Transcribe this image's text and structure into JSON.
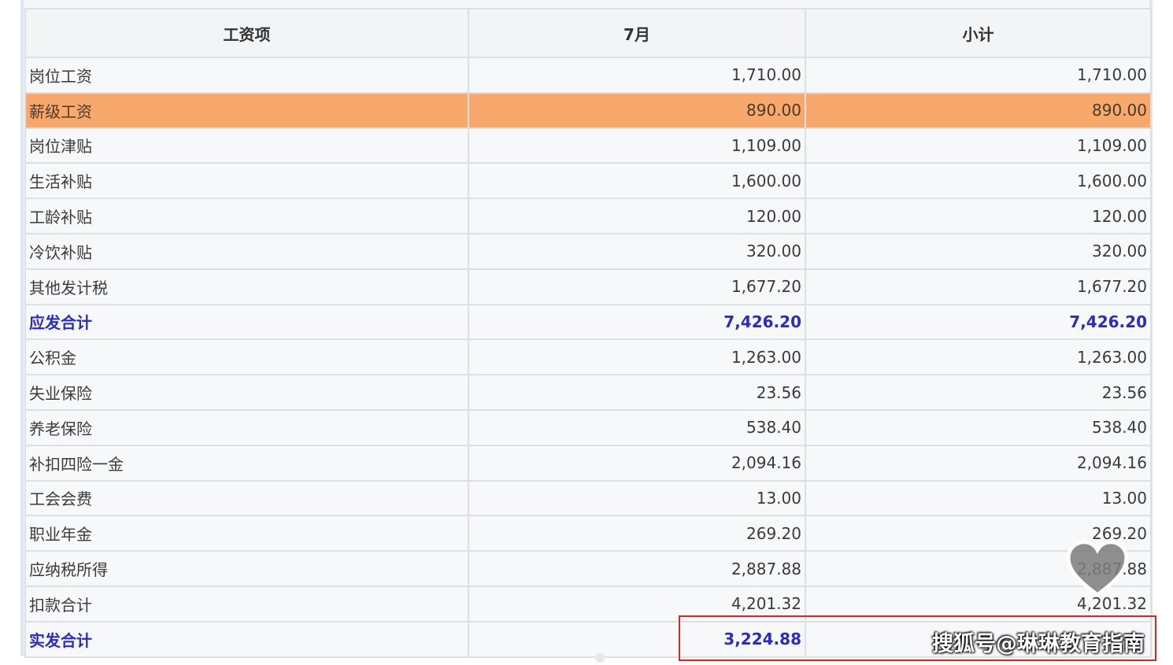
{
  "table": {
    "headers": [
      "工资项",
      "7月",
      "小计"
    ],
    "rows": [
      {
        "item": "岗位工资",
        "july": "1,710.00",
        "subtotal": "1,710.00"
      },
      {
        "item": "薪级工资",
        "july": "890.00",
        "subtotal": "890.00"
      },
      {
        "item": "岗位津贴",
        "july": "1,109.00",
        "subtotal": "1,109.00"
      },
      {
        "item": "生活补贴",
        "july": "1,600.00",
        "subtotal": "1,600.00"
      },
      {
        "item": "工龄补贴",
        "july": "120.00",
        "subtotal": "120.00"
      },
      {
        "item": "冷饮补贴",
        "july": "320.00",
        "subtotal": "320.00"
      },
      {
        "item": "其他发计税",
        "july": "1,677.20",
        "subtotal": "1,677.20"
      },
      {
        "item": "应发合计",
        "july": "7,426.20",
        "subtotal": "7,426.20"
      },
      {
        "item": "公积金",
        "july": "1,263.00",
        "subtotal": "1,263.00"
      },
      {
        "item": "失业保险",
        "july": "23.56",
        "subtotal": "23.56"
      },
      {
        "item": "养老保险",
        "july": "538.40",
        "subtotal": "538.40"
      },
      {
        "item": "补扣四险一金",
        "july": "2,094.16",
        "subtotal": "2,094.16"
      },
      {
        "item": "工会会费",
        "july": "13.00",
        "subtotal": "13.00"
      },
      {
        "item": "职业年金",
        "july": "269.20",
        "subtotal": "269.20"
      },
      {
        "item": "应纳税所得",
        "july": "2,887.88",
        "subtotal": "2,887.88"
      },
      {
        "item": "扣款合计",
        "july": "4,201.32",
        "subtotal": "4,201.32"
      },
      {
        "item": "实发合计",
        "july": "3,224.88",
        "subtotal": ""
      }
    ]
  },
  "watermark": "搜狐号@琳琳教育指南",
  "colors": {
    "highlight_row": "#f7a86a",
    "total_text": "#2b2bc4",
    "annotation_box": "#e02424"
  },
  "icons": {
    "heart": "heart-icon"
  }
}
